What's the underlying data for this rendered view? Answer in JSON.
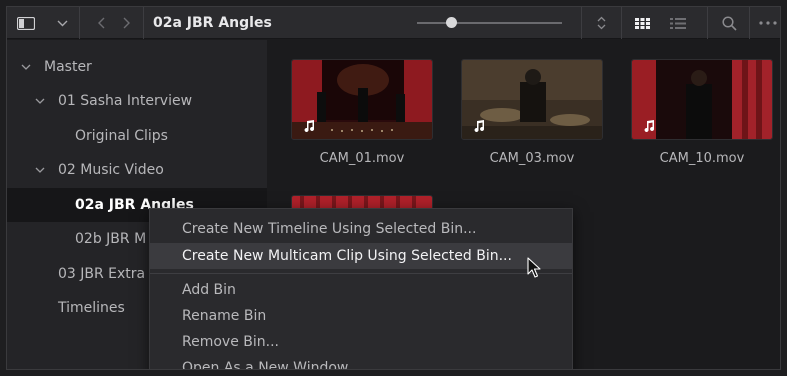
{
  "toolbar": {
    "bin_title": "02a JBR Angles",
    "icons": [
      "panel-toggle-icon",
      "chevron-down-icon",
      "back-icon",
      "forward-icon",
      "sort-icon",
      "grid-view-icon",
      "list-view-icon",
      "search-icon",
      "more-icon"
    ],
    "thumbnail_size_fraction": 0.24
  },
  "sidebar": {
    "items": [
      {
        "label": "Master",
        "expanded": true
      },
      {
        "label": "01 Sasha Interview",
        "expanded": true
      },
      {
        "label": "Original Clips"
      },
      {
        "label": "02 Music Video",
        "expanded": true
      },
      {
        "label": "02a JBR Angles",
        "selected": true
      },
      {
        "label": "02b JBR M"
      },
      {
        "label": "03 JBR Extra"
      },
      {
        "label": "Timelines"
      }
    ]
  },
  "clips": [
    {
      "name": "CAM_01.mov"
    },
    {
      "name": "CAM_03.mov"
    },
    {
      "name": "CAM_10.mov"
    }
  ],
  "context_menu": {
    "items": [
      "Create New Timeline Using Selected Bin...",
      "Create New Multicam Clip Using Selected Bin...",
      "Add Bin",
      "Rename Bin",
      "Remove Bin...",
      "Open As a New Window"
    ],
    "highlighted_index": 1
  },
  "colors": {
    "selected_row": "#161618",
    "menu_highlight": "#3b3b3f",
    "stage_red": "#b0212a"
  }
}
